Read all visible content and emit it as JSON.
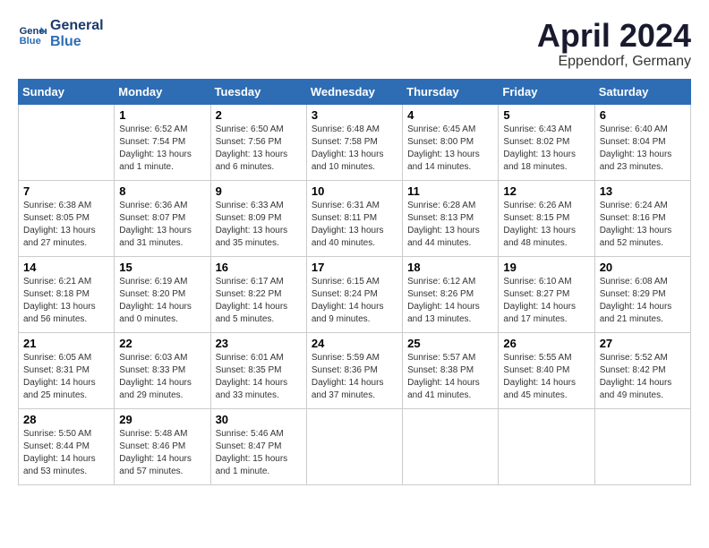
{
  "logo": {
    "line1": "General",
    "line2": "Blue"
  },
  "title": "April 2024",
  "subtitle": "Eppendorf, Germany",
  "days_of_week": [
    "Sunday",
    "Monday",
    "Tuesday",
    "Wednesday",
    "Thursday",
    "Friday",
    "Saturday"
  ],
  "weeks": [
    [
      {
        "day": "",
        "info": ""
      },
      {
        "day": "1",
        "info": "Sunrise: 6:52 AM\nSunset: 7:54 PM\nDaylight: 13 hours\nand 1 minute."
      },
      {
        "day": "2",
        "info": "Sunrise: 6:50 AM\nSunset: 7:56 PM\nDaylight: 13 hours\nand 6 minutes."
      },
      {
        "day": "3",
        "info": "Sunrise: 6:48 AM\nSunset: 7:58 PM\nDaylight: 13 hours\nand 10 minutes."
      },
      {
        "day": "4",
        "info": "Sunrise: 6:45 AM\nSunset: 8:00 PM\nDaylight: 13 hours\nand 14 minutes."
      },
      {
        "day": "5",
        "info": "Sunrise: 6:43 AM\nSunset: 8:02 PM\nDaylight: 13 hours\nand 18 minutes."
      },
      {
        "day": "6",
        "info": "Sunrise: 6:40 AM\nSunset: 8:04 PM\nDaylight: 13 hours\nand 23 minutes."
      }
    ],
    [
      {
        "day": "7",
        "info": "Sunrise: 6:38 AM\nSunset: 8:05 PM\nDaylight: 13 hours\nand 27 minutes."
      },
      {
        "day": "8",
        "info": "Sunrise: 6:36 AM\nSunset: 8:07 PM\nDaylight: 13 hours\nand 31 minutes."
      },
      {
        "day": "9",
        "info": "Sunrise: 6:33 AM\nSunset: 8:09 PM\nDaylight: 13 hours\nand 35 minutes."
      },
      {
        "day": "10",
        "info": "Sunrise: 6:31 AM\nSunset: 8:11 PM\nDaylight: 13 hours\nand 40 minutes."
      },
      {
        "day": "11",
        "info": "Sunrise: 6:28 AM\nSunset: 8:13 PM\nDaylight: 13 hours\nand 44 minutes."
      },
      {
        "day": "12",
        "info": "Sunrise: 6:26 AM\nSunset: 8:15 PM\nDaylight: 13 hours\nand 48 minutes."
      },
      {
        "day": "13",
        "info": "Sunrise: 6:24 AM\nSunset: 8:16 PM\nDaylight: 13 hours\nand 52 minutes."
      }
    ],
    [
      {
        "day": "14",
        "info": "Sunrise: 6:21 AM\nSunset: 8:18 PM\nDaylight: 13 hours\nand 56 minutes."
      },
      {
        "day": "15",
        "info": "Sunrise: 6:19 AM\nSunset: 8:20 PM\nDaylight: 14 hours\nand 0 minutes."
      },
      {
        "day": "16",
        "info": "Sunrise: 6:17 AM\nSunset: 8:22 PM\nDaylight: 14 hours\nand 5 minutes."
      },
      {
        "day": "17",
        "info": "Sunrise: 6:15 AM\nSunset: 8:24 PM\nDaylight: 14 hours\nand 9 minutes."
      },
      {
        "day": "18",
        "info": "Sunrise: 6:12 AM\nSunset: 8:26 PM\nDaylight: 14 hours\nand 13 minutes."
      },
      {
        "day": "19",
        "info": "Sunrise: 6:10 AM\nSunset: 8:27 PM\nDaylight: 14 hours\nand 17 minutes."
      },
      {
        "day": "20",
        "info": "Sunrise: 6:08 AM\nSunset: 8:29 PM\nDaylight: 14 hours\nand 21 minutes."
      }
    ],
    [
      {
        "day": "21",
        "info": "Sunrise: 6:05 AM\nSunset: 8:31 PM\nDaylight: 14 hours\nand 25 minutes."
      },
      {
        "day": "22",
        "info": "Sunrise: 6:03 AM\nSunset: 8:33 PM\nDaylight: 14 hours\nand 29 minutes."
      },
      {
        "day": "23",
        "info": "Sunrise: 6:01 AM\nSunset: 8:35 PM\nDaylight: 14 hours\nand 33 minutes."
      },
      {
        "day": "24",
        "info": "Sunrise: 5:59 AM\nSunset: 8:36 PM\nDaylight: 14 hours\nand 37 minutes."
      },
      {
        "day": "25",
        "info": "Sunrise: 5:57 AM\nSunset: 8:38 PM\nDaylight: 14 hours\nand 41 minutes."
      },
      {
        "day": "26",
        "info": "Sunrise: 5:55 AM\nSunset: 8:40 PM\nDaylight: 14 hours\nand 45 minutes."
      },
      {
        "day": "27",
        "info": "Sunrise: 5:52 AM\nSunset: 8:42 PM\nDaylight: 14 hours\nand 49 minutes."
      }
    ],
    [
      {
        "day": "28",
        "info": "Sunrise: 5:50 AM\nSunset: 8:44 PM\nDaylight: 14 hours\nand 53 minutes."
      },
      {
        "day": "29",
        "info": "Sunrise: 5:48 AM\nSunset: 8:46 PM\nDaylight: 14 hours\nand 57 minutes."
      },
      {
        "day": "30",
        "info": "Sunrise: 5:46 AM\nSunset: 8:47 PM\nDaylight: 15 hours\nand 1 minute."
      },
      {
        "day": "",
        "info": ""
      },
      {
        "day": "",
        "info": ""
      },
      {
        "day": "",
        "info": ""
      },
      {
        "day": "",
        "info": ""
      }
    ]
  ]
}
